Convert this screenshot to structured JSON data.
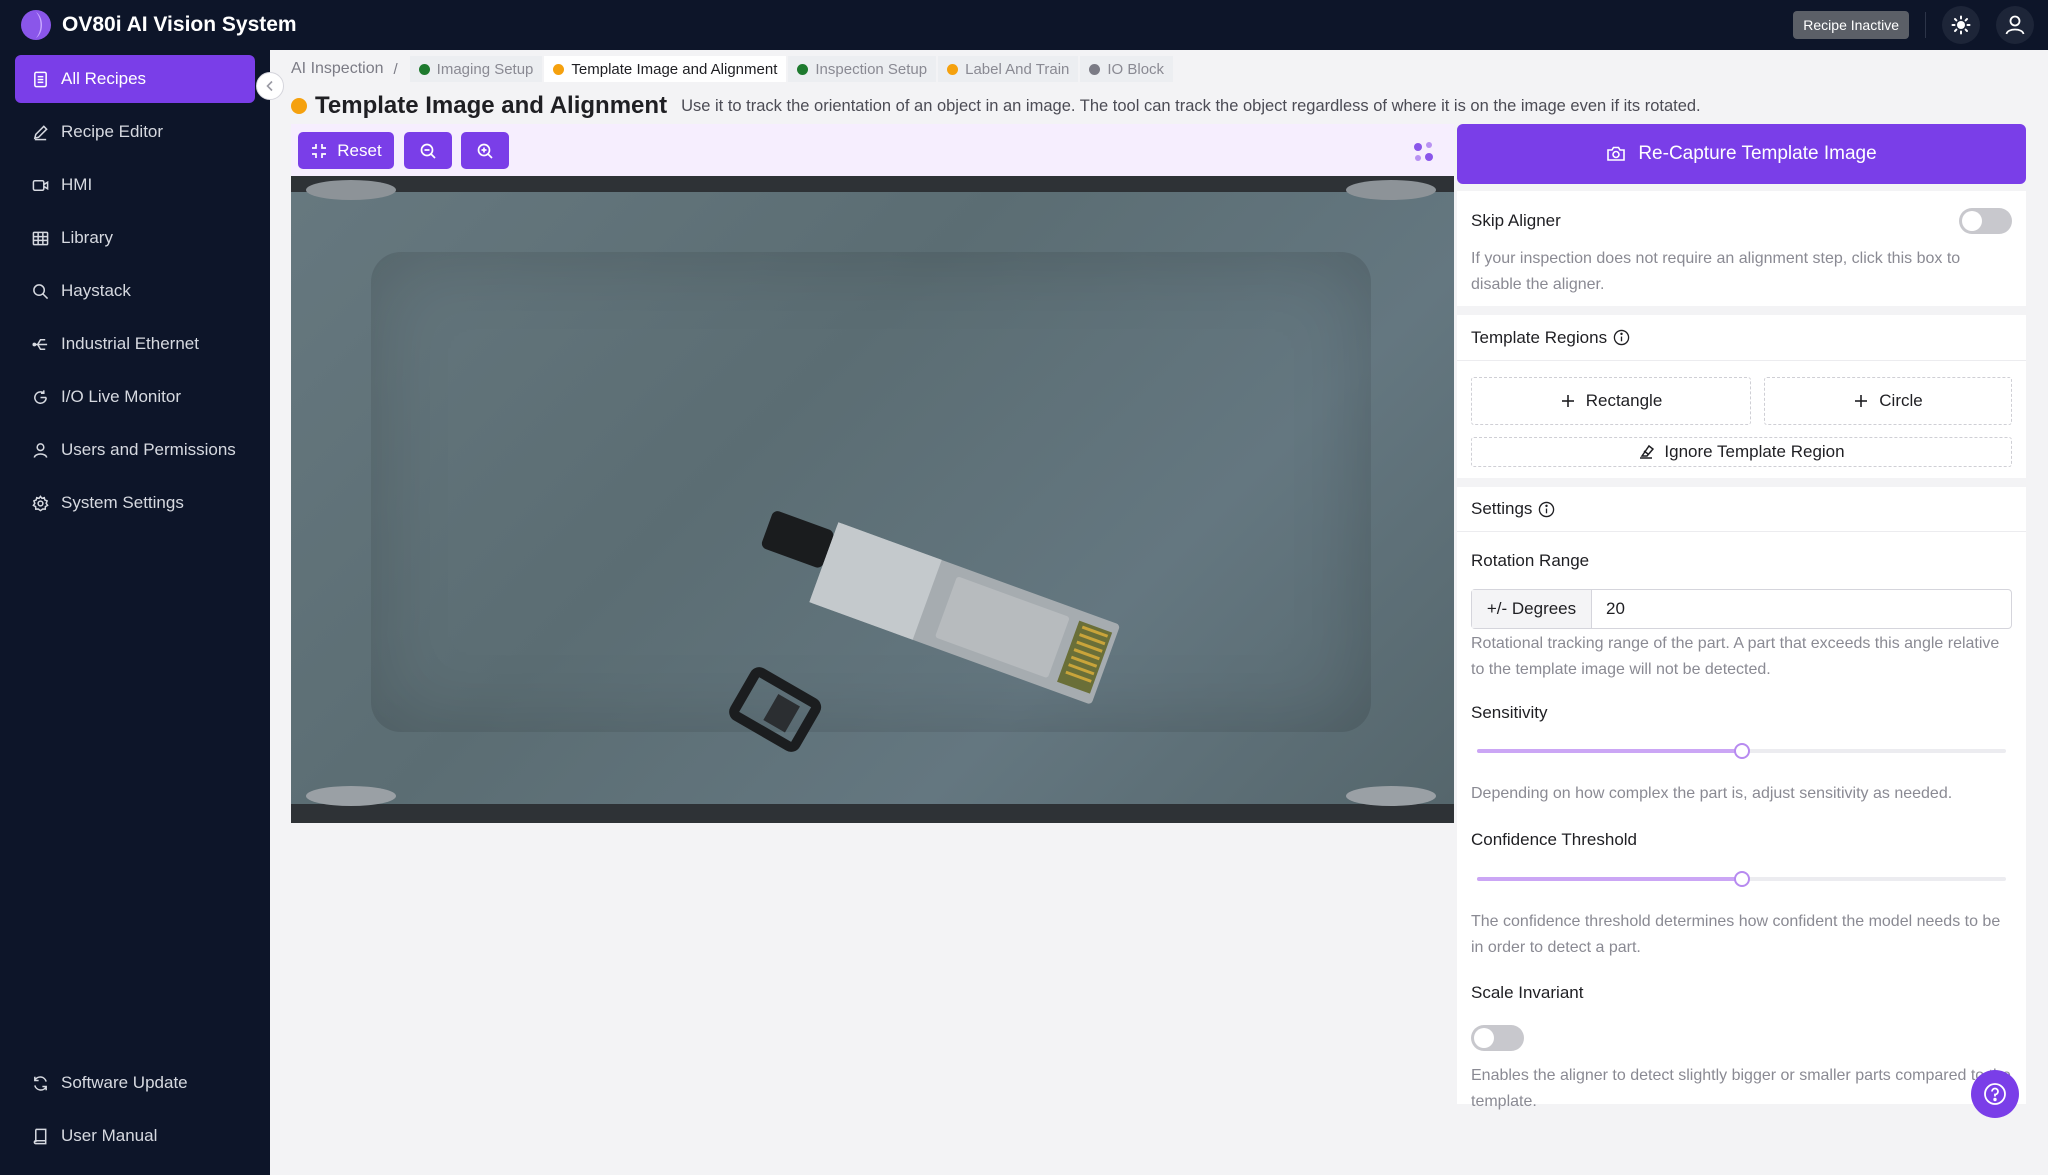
{
  "app": {
    "title": "OV80i AI Vision System",
    "status": "Recipe Inactive"
  },
  "sidebar": {
    "items": [
      {
        "label": "All Recipes",
        "icon": "document-icon",
        "active": true
      },
      {
        "label": "Recipe Editor",
        "icon": "pencil-icon"
      },
      {
        "label": "HMI",
        "icon": "video-icon"
      },
      {
        "label": "Library",
        "icon": "table-icon"
      },
      {
        "label": "Haystack",
        "icon": "search-icon"
      },
      {
        "label": "Industrial Ethernet",
        "icon": "network-icon"
      },
      {
        "label": "I/O Live Monitor",
        "icon": "refresh-icon"
      },
      {
        "label": "Users and Permissions",
        "icon": "user-icon"
      },
      {
        "label": "System Settings",
        "icon": "gear-icon"
      }
    ],
    "bottom": [
      {
        "label": "Software Update",
        "icon": "sync-icon"
      },
      {
        "label": "User Manual",
        "icon": "book-icon"
      }
    ]
  },
  "breadcrumb": {
    "root": "AI Inspection",
    "separator": "/",
    "steps": [
      {
        "label": "Imaging Setup",
        "color": "#1e7a2e"
      },
      {
        "label": "Template Image and Alignment",
        "color": "#f5a10e",
        "current": true
      },
      {
        "label": "Inspection Setup",
        "color": "#1e7a2e"
      },
      {
        "label": "Label And Train",
        "color": "#f5a10e"
      },
      {
        "label": "IO Block",
        "color": "#7b7b85"
      }
    ]
  },
  "page": {
    "title": "Template Image and Alignment",
    "description": "Use it to track the orientation of an object in an image. The tool can track the object regardless of where it is on the image even if its rotated."
  },
  "toolbar": {
    "reset_label": "Reset",
    "zoom_out_icon": "zoom-out-icon",
    "zoom_in_icon": "zoom-in-icon"
  },
  "panel": {
    "capture_label": "Re-Capture Template Image",
    "skip_aligner": {
      "label": "Skip Aligner",
      "enabled": false,
      "help": "If your inspection does not require an alignment step, click this box to disable the aligner."
    },
    "template_regions": {
      "label": "Template Regions",
      "rectangle_label": "Rectangle",
      "circle_label": "Circle",
      "ignore_label": "Ignore Template Region"
    },
    "settings": {
      "label": "Settings",
      "rotation": {
        "label": "Rotation Range",
        "addon": "+/- Degrees",
        "value": "20",
        "help": "Rotational tracking range of the part. A part that exceeds this angle relative to the template image will not be detected."
      },
      "sensitivity": {
        "label": "Sensitivity",
        "level": 0.5,
        "help": "Depending on how complex the part is, adjust sensitivity as needed."
      },
      "confidence": {
        "label": "Confidence Threshold",
        "level": 0.5,
        "help": "The confidence threshold determines how confident the model needs to be in order to detect a part."
      },
      "scale_invariant": {
        "label": "Scale Invariant",
        "enabled": false,
        "help": "Enables the aligner to detect slightly bigger or smaller parts compared to the template."
      }
    }
  },
  "colors": {
    "accent": "#7a3ee8",
    "nav_bg": "#0d1529",
    "warning": "#f5a10e",
    "ok": "#1e7a2e"
  }
}
